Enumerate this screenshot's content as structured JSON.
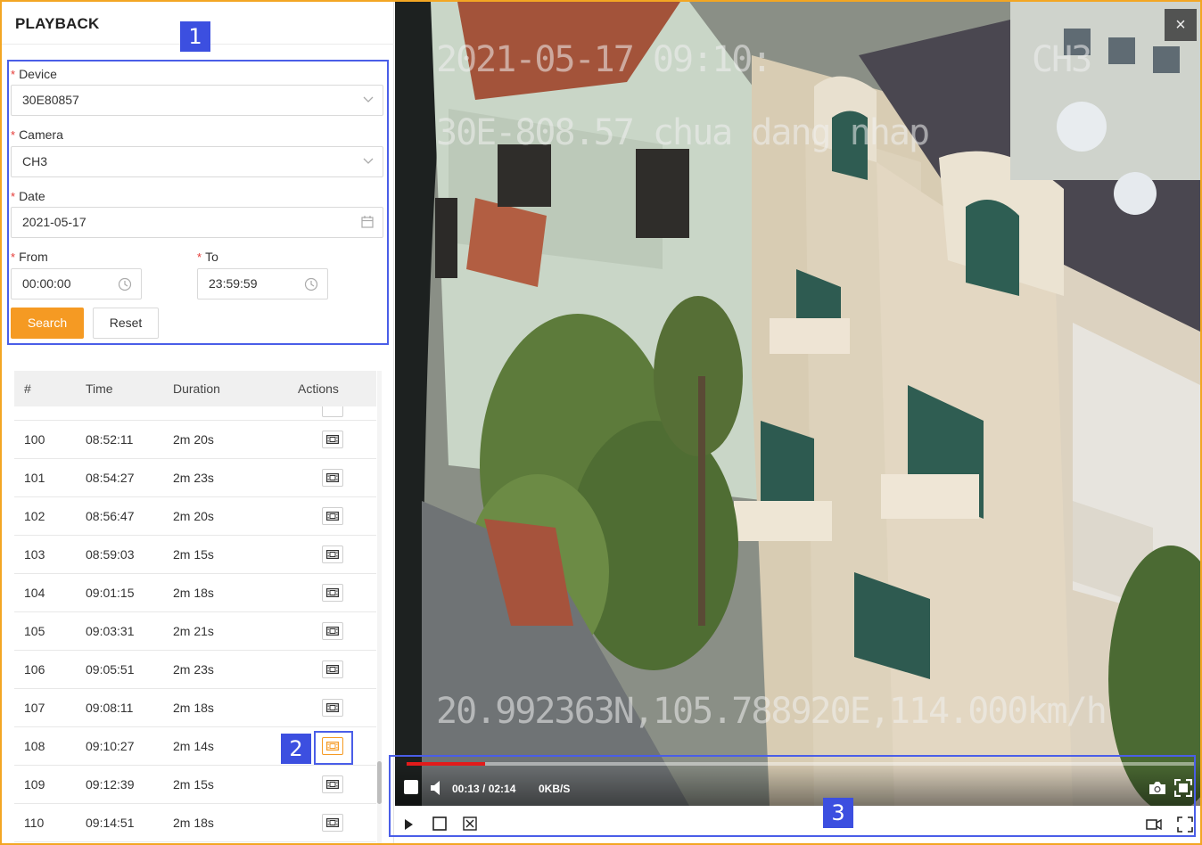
{
  "panel": {
    "title": "PLAYBACK"
  },
  "form": {
    "device_label": "Device",
    "device_value": "30E80857",
    "camera_label": "Camera",
    "camera_value": "CH3",
    "date_label": "Date",
    "date_value": "2021-05-17",
    "from_label": "From",
    "from_value": "00:00:00",
    "to_label": "To",
    "to_value": "23:59:59",
    "required_mark": "*",
    "search_label": "Search",
    "reset_label": "Reset"
  },
  "table": {
    "headers": {
      "index": "#",
      "time": "Time",
      "duration": "Duration",
      "actions": "Actions"
    },
    "rows": [
      {
        "index": "100",
        "time": "08:52:11",
        "duration": "2m 20s"
      },
      {
        "index": "101",
        "time": "08:54:27",
        "duration": "2m 23s"
      },
      {
        "index": "102",
        "time": "08:56:47",
        "duration": "2m 20s"
      },
      {
        "index": "103",
        "time": "08:59:03",
        "duration": "2m 15s"
      },
      {
        "index": "104",
        "time": "09:01:15",
        "duration": "2m 18s"
      },
      {
        "index": "105",
        "time": "09:03:31",
        "duration": "2m 21s"
      },
      {
        "index": "106",
        "time": "09:05:51",
        "duration": "2m 23s"
      },
      {
        "index": "107",
        "time": "09:08:11",
        "duration": "2m 18s"
      },
      {
        "index": "108",
        "time": "09:10:27",
        "duration": "2m 14s",
        "active": true
      },
      {
        "index": "109",
        "time": "09:12:39",
        "duration": "2m 15s"
      },
      {
        "index": "110",
        "time": "09:14:51",
        "duration": "2m 18s"
      }
    ]
  },
  "video": {
    "osd_datetime": "2021-05-17 09:10:",
    "osd_channel": "CH3",
    "osd_plate": "30E-808.57 chua dang nhap",
    "osd_gps": "20.992363N,105.788920E,114.000km/h",
    "close_symbol": "×"
  },
  "player": {
    "time": "00:13 / 02:14",
    "rate": "0KB/S",
    "progress": 0.1
  },
  "annotations": {
    "a1": "1",
    "a2": "2",
    "a3": "3"
  },
  "colors": {
    "accent": "#f59a23",
    "annotation": "#3c4fe0",
    "required": "#e53935",
    "progress": "#e21b1b"
  },
  "icons": [
    "chevron-down-icon",
    "calendar-icon",
    "clock-icon",
    "film-icon",
    "close-icon",
    "stop-icon",
    "volume-icon",
    "camera-icon",
    "expand-icon",
    "play-icon",
    "record-icon",
    "fullscreen-icon"
  ]
}
